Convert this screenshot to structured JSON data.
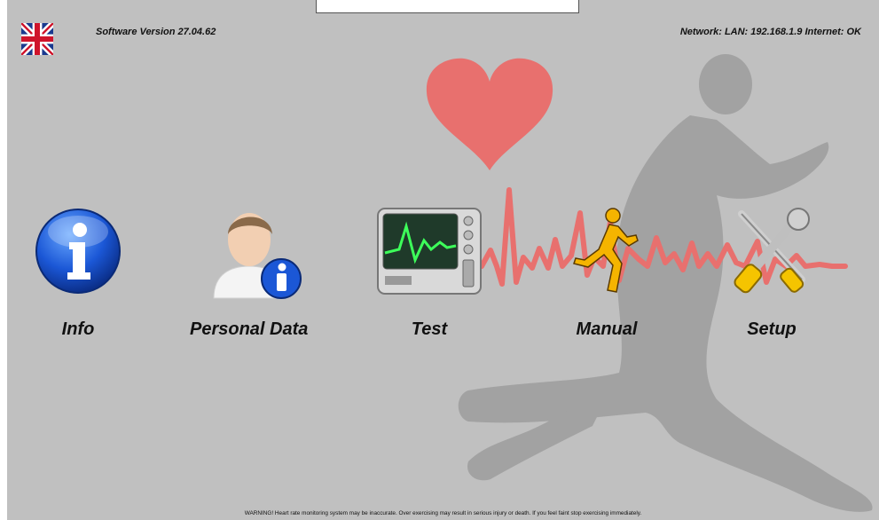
{
  "header": {
    "software_version": "Software Version 27.04.62",
    "network_status": "Network: LAN: 192.168.1.9 Internet: OK",
    "language_flag": "uk-flag-icon"
  },
  "menu": {
    "items": [
      {
        "label": "Info",
        "icon": "info-icon"
      },
      {
        "label": "Personal Data",
        "icon": "user-info-icon"
      },
      {
        "label": "Test",
        "icon": "monitor-icon"
      },
      {
        "label": "Manual",
        "icon": "runner-icon"
      },
      {
        "label": "Setup",
        "icon": "tools-icon"
      }
    ]
  },
  "footer": {
    "warning": "WARNING! Heart rate monitoring system may be inaccurate. Over exercising may result in serious injury or death. If you feel faint stop exercising immediately."
  },
  "colors": {
    "background": "#c0c0c0",
    "heart": "#e8706e",
    "ecg": "#e8706e",
    "runner_silhouette": "#9a9a9a"
  }
}
